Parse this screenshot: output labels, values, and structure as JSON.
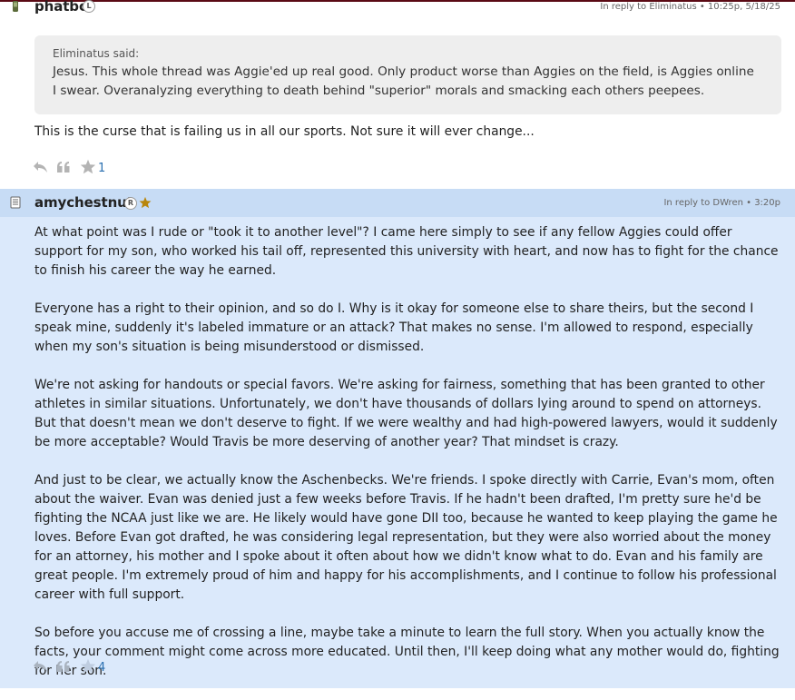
{
  "post1": {
    "username": "phatbc",
    "badge": "L",
    "reply_meta": "In reply to Eliminatus • 10:25p, 5/18/25",
    "quote_author": "Eliminatus said:",
    "quote_text": "Jesus. This whole thread was Aggie'ed up real good. Only product worse than Aggies on the field, is Aggies online I swear. Overanalyzing everything to death behind \"superior\" morals and smacking each others peepees.",
    "body": "This is the curse that is failing us in all our sports. Not sure it will ever change...",
    "like_count": "1",
    "icons": [
      "phone-icon",
      "reply-icon",
      "quote-icon",
      "star-icon"
    ]
  },
  "post2": {
    "username": "amychestnut",
    "badge": "R",
    "reply_meta": "In reply to DWren • 3:20p",
    "paragraphs": [
      "At what point was I rude or \"took it to another level\"? I came here simply to see if any fellow Aggies could offer support for my son, who worked his tail off, represented this university with heart, and now has to fight for the chance to finish his career the way he earned.",
      "Everyone has a right to their opinion, and so do I. Why is it okay for someone else to share theirs, but the second I speak mine, suddenly it's labeled immature or an attack? That makes no sense. I'm allowed to respond, especially when my son's situation is being misunderstood or dismissed.",
      "We're not asking for handouts or special favors. We're asking for fairness, something that has been granted to other athletes in similar situations. Unfortunately, we don't have thousands of dollars lying around to spend on attorneys. But that doesn't mean we don't deserve to fight. If we were wealthy and had high-powered lawyers, would it suddenly be more acceptable? Would Travis be more deserving of another year? That mindset is crazy.",
      "And just to be clear, we actually know the Aschenbecks. We're friends. I spoke directly with Carrie, Evan's mom, often about the waiver. Evan was denied just a few weeks before Travis. If he hadn't been drafted, I'm pretty sure he'd be fighting the NCAA just like we are. He likely would have gone DII too, because he wanted to keep playing the game he loves. Before Evan got drafted, he was considering legal representation, but they were also worried about the money for an attorney, his mother and I spoke about it often about how we didn't know what to do. Evan and his family are great people. I'm extremely proud of him and happy for his accomplishments, and I continue to follow his professional career with full support.",
      "So before you accuse me of crossing a line, maybe take a minute to learn the full story. When you actually know the facts, your comment might come across more educated. Until then, I'll keep doing what any mother would do, fighting for her son."
    ],
    "like_count": "4",
    "icons": [
      "document-icon",
      "gold-star-icon",
      "reply-icon",
      "quote-icon",
      "star-icon"
    ]
  },
  "colors": {
    "top_border": "#5a0a14",
    "post2_background": "#dbe9fb",
    "post2_header": "#c7dcf5",
    "quote_background": "#eeeeee",
    "link_blue": "#2a6fb0",
    "gold": "#b8860b"
  }
}
